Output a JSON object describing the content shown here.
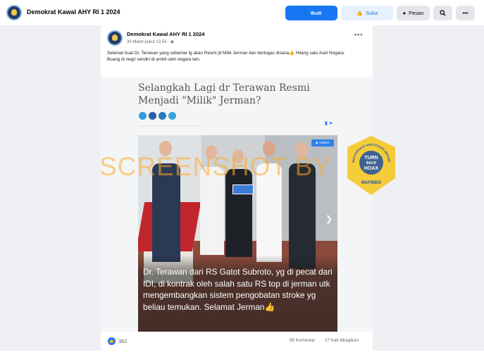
{
  "header": {
    "page_name": "Demokrat Kawal AHY RI 1 2024",
    "follow_label": "Ikuti",
    "like_label": "Suka",
    "message_label": "Pesan",
    "more_label": "•••"
  },
  "post": {
    "author": "Demokrat Kawal AHY RI 1 2024",
    "time": "30 Maret pukul 13.54 ·",
    "menu": "•••",
    "caption_line1": "Selamat buat Dr. Terawan yang sebentar lg akan Resmi jd Milik Jerman dan bertugas disana👍 Hilang satu Aset Negara.",
    "caption_line2": "Buang di negri sendiri di ambil oleh negara lain."
  },
  "shared_article": {
    "title": "Selangkah Lagi dr Terawan Resmi Menjadi \"Milik\" Jerman?",
    "video_tag": "▶ VIDEO",
    "overlay_text": "Dr. Terawan dari RS Gatot Subroto, yg di pecat dari IDI, di kontrak oleh salah satu RS top di jerman utk mengembangkan sistem pengobatan stroke yg beliau temukan. Selamat Jerman👍"
  },
  "watermark": {
    "text": "SCREENSHOT BY"
  },
  "badge": {
    "line1": "TURN",
    "line2": "BACK",
    "line3": "HOAX",
    "ring_text": "MASYARAKAT ANTI FITNAH INDONESIA",
    "bottom_text": "MAFINDO",
    "color": "#f5c518"
  },
  "footer": {
    "like_count": "362",
    "comments": "95 Komentar",
    "shares": "27 Kali dibagikan"
  },
  "colors": {
    "primary": "#1877f2",
    "watermark": "#ffaa28"
  }
}
